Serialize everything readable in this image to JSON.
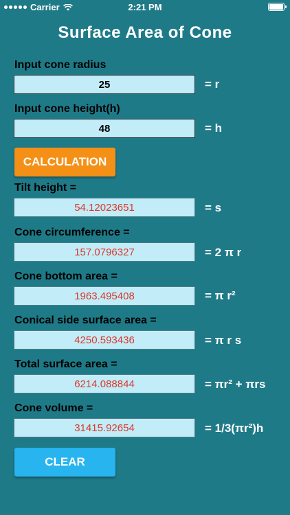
{
  "status_bar": {
    "carrier": "Carrier",
    "time": "2:21 PM"
  },
  "title": "Surface Area of Cone",
  "inputs": {
    "radius": {
      "label": "Input cone radius",
      "value": "25",
      "suffix": "= r"
    },
    "height": {
      "label": "Input cone height(h)",
      "value": "48",
      "suffix": "= h"
    }
  },
  "calc_button": "CALCULATION",
  "results": [
    {
      "label": "Tilt height =",
      "value": "54.12023651",
      "formula": "= s"
    },
    {
      "label": "Cone circumference =",
      "value": "157.0796327",
      "formula": "= 2 π r"
    },
    {
      "label": "Cone bottom area =",
      "value": "1963.495408",
      "formula": "= π r²"
    },
    {
      "label": "Conical side surface area =",
      "value": "4250.593436",
      "formula": "= π r s"
    },
    {
      "label": "Total surface area =",
      "value": "6214.088844",
      "formula": "= πr² + πrs"
    },
    {
      "label": "Cone volume =",
      "value": "31415.92654",
      "formula": "= 1/3(πr²)h"
    }
  ],
  "clear_button": "CLEAR",
  "colors": {
    "background": "#1f7a88",
    "field": "#c3ecf9",
    "result_text": "#d93a2a",
    "calc_button": "#f59017",
    "clear_button": "#27b4ef"
  }
}
